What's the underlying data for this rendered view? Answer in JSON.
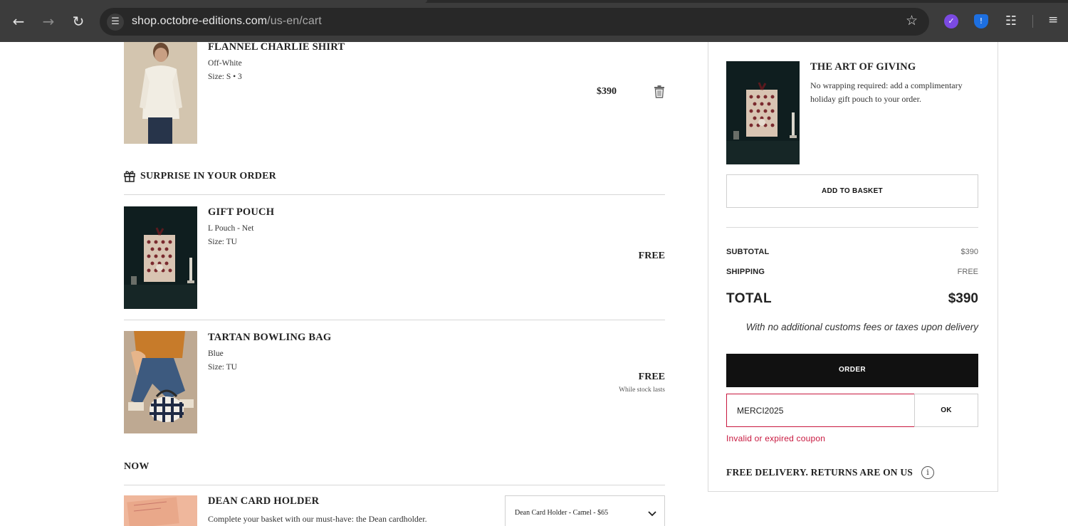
{
  "browser": {
    "url_host": "shop.octobre-editions.com",
    "url_path": "/us-en/cart"
  },
  "cart_items": [
    {
      "title": "FLANNEL CHARLIE SHIRT",
      "color": "Off-White",
      "size": "Size: S • 3",
      "price": "$390"
    }
  ],
  "surprise": {
    "heading": "SURPRISE IN YOUR ORDER",
    "items": [
      {
        "title": "GIFT POUCH",
        "color": "L Pouch - Net",
        "size": "Size: TU",
        "price": "FREE"
      },
      {
        "title": "TARTAN BOWLING BAG",
        "color": "Blue",
        "size": "Size: TU",
        "price": "FREE",
        "note": "While stock lasts"
      }
    ]
  },
  "now": {
    "heading": "NOW",
    "item": {
      "title": "DEAN CARD HOLDER",
      "description": "Complete your basket with our must-have: the Dean cardholder.",
      "select_value": "Dean Card Holder - Camel - $65"
    }
  },
  "summary": {
    "gift": {
      "title": "THE ART OF GIVING",
      "description": "No wrapping required: add a complimentary holiday gift pouch to your order.",
      "button": "ADD TO BASKET"
    },
    "subtotal_label": "SUBTOTAL",
    "subtotal_value": "$390",
    "shipping_label": "SHIPPING",
    "shipping_value": "FREE",
    "total_label": "TOTAL",
    "total_value": "$390",
    "customs_note": "With no additional customs fees or taxes upon delivery",
    "order_button": "ORDER",
    "coupon_value": "MERCI2025",
    "coupon_button": "OK",
    "coupon_error": "Invalid or expired coupon",
    "delivery_note": "FREE DELIVERY. RETURNS ARE ON US",
    "error_color": "#c8183f"
  },
  "icons": {
    "trash": "trash-icon",
    "gift": "gift-icon",
    "info": "info-icon",
    "chevron": "chevron-down-icon"
  }
}
